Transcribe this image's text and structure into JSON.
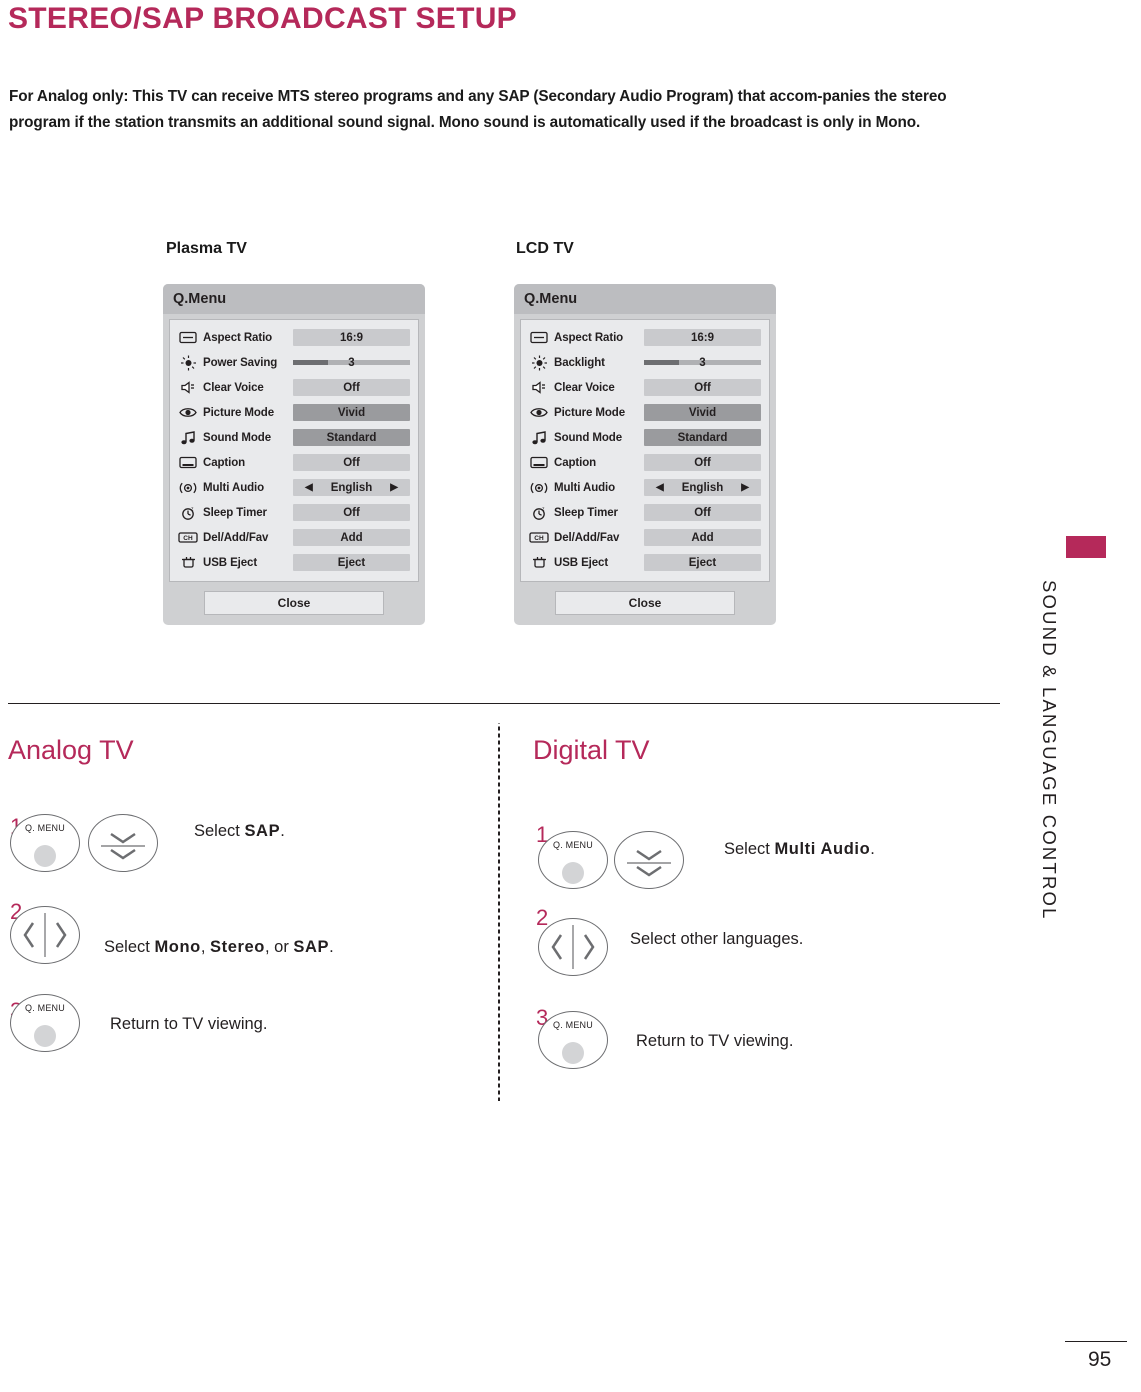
{
  "page": {
    "title": "STEREO/SAP BROADCAST SETUP",
    "intro": "For Analog only: This TV can receive MTS stereo programs and any SAP (Secondary Audio Program) that accom-panies the stereo program if the station transmits an additional sound signal. Mono sound is automatically used if the broadcast is only in Mono.",
    "side_tab_label": "SOUND & LANGUAGE CONTROL",
    "page_number": "95"
  },
  "plasma": {
    "caption": "Plasma TV",
    "menu_title": "Q.Menu",
    "close_label": "Close",
    "rows": [
      {
        "icon": "aspect-ratio-icon",
        "label": "Aspect Ratio",
        "value": "16:9",
        "type": "text"
      },
      {
        "icon": "power-saving-icon",
        "label": "Power Saving",
        "value": "3",
        "type": "slider"
      },
      {
        "icon": "clear-voice-icon",
        "label": "Clear Voice",
        "value": "Off",
        "type": "text"
      },
      {
        "icon": "picture-mode-icon",
        "label": "Picture Mode",
        "value": "Vivid",
        "type": "text"
      },
      {
        "icon": "sound-mode-icon",
        "label": "Sound Mode",
        "value": "Standard",
        "type": "text"
      },
      {
        "icon": "caption-icon",
        "label": "Caption",
        "value": "Off",
        "type": "text"
      },
      {
        "icon": "multi-audio-icon",
        "label": "Multi Audio",
        "value": "English",
        "type": "audio"
      },
      {
        "icon": "sleep-timer-icon",
        "label": "Sleep Timer",
        "value": "Off",
        "type": "text"
      },
      {
        "icon": "del-add-fav-icon",
        "label": "Del/Add/Fav",
        "value": "Add",
        "type": "text"
      },
      {
        "icon": "usb-eject-icon",
        "label": "USB Eject",
        "value": "Eject",
        "type": "text"
      }
    ]
  },
  "lcd": {
    "caption": "LCD TV",
    "menu_title": "Q.Menu",
    "close_label": "Close",
    "rows": [
      {
        "icon": "aspect-ratio-icon",
        "label": "Aspect Ratio",
        "value": "16:9",
        "type": "text"
      },
      {
        "icon": "backlight-icon",
        "label": "Backlight",
        "value": "3",
        "type": "slider"
      },
      {
        "icon": "clear-voice-icon",
        "label": "Clear Voice",
        "value": "Off",
        "type": "text"
      },
      {
        "icon": "picture-mode-icon",
        "label": "Picture Mode",
        "value": "Vivid",
        "type": "text"
      },
      {
        "icon": "sound-mode-icon",
        "label": "Sound Mode",
        "value": "Standard",
        "type": "text"
      },
      {
        "icon": "caption-icon",
        "label": "Caption",
        "value": "Off",
        "type": "text"
      },
      {
        "icon": "multi-audio-icon",
        "label": "Multi Audio",
        "value": "English",
        "type": "audio"
      },
      {
        "icon": "sleep-timer-icon",
        "label": "Sleep Timer",
        "value": "Off",
        "type": "text"
      },
      {
        "icon": "del-add-fav-icon",
        "label": "Del/Add/Fav",
        "value": "Add",
        "type": "text"
      },
      {
        "icon": "usb-eject-icon",
        "label": "USB Eject",
        "value": "Eject",
        "type": "text"
      }
    ]
  },
  "analog": {
    "heading": "Analog TV",
    "steps": [
      {
        "num": "1",
        "button_label": "Q. MENU",
        "text_prefix": "Select ",
        "keyword": "SAP",
        "text_suffix": "."
      },
      {
        "num": "2",
        "button_label": "",
        "text_prefix": "Select ",
        "keyword": "Mono",
        "keyword2": "Stereo",
        "keyword3": "SAP",
        "text_suffix": "."
      },
      {
        "num": "3",
        "button_label": "Q. MENU",
        "text_prefix": "Return to TV viewing.",
        "keyword": "",
        "text_suffix": ""
      }
    ],
    "step2_text": "Select Mono, Stereo, or SAP.",
    "step3_text": "Return to TV viewing."
  },
  "digital": {
    "heading": "Digital TV",
    "steps": [
      {
        "num": "1",
        "button_label": "Q. MENU",
        "text_prefix": "Select ",
        "keyword": "Multi Audio",
        "text_suffix": "."
      },
      {
        "num": "2",
        "button_label": "",
        "text_prefix": "Select other languages.",
        "keyword": "",
        "text_suffix": ""
      },
      {
        "num": "3",
        "button_label": "Q. MENU",
        "text_prefix": "Return to TV viewing.",
        "keyword": "",
        "text_suffix": ""
      }
    ],
    "step2_text": "Select other languages.",
    "step3_text": "Return to TV viewing."
  },
  "labels": {
    "comma": ", ",
    "or": ", or "
  },
  "colors": {
    "accent": "#b5295a",
    "menu_bg": "#cfd0d2",
    "menu_header": "#bcbdc0",
    "menu_panel": "#e9eaec",
    "value_bg": "#c9cacd",
    "value_highlight": "#9a9b9e",
    "text": "#231f20"
  }
}
